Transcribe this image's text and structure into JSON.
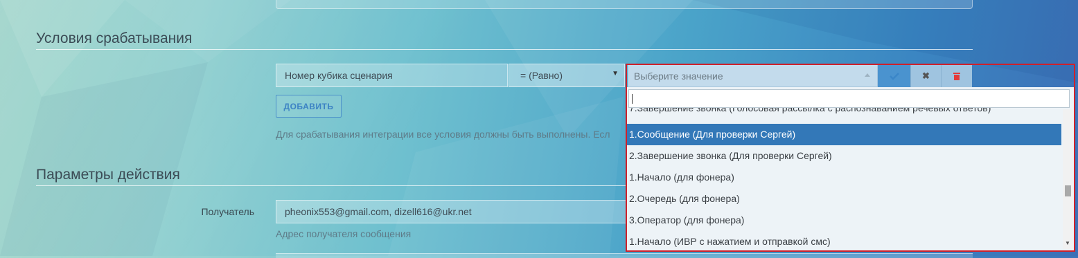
{
  "sections": {
    "conditions_title": "Условия срабатывания",
    "action_title": "Параметры действия"
  },
  "condition": {
    "field_value": "Номер кубика сценария",
    "operator_value": "= (Равно)",
    "value_placeholder": "Выберите значение",
    "add_label": "ДОБАВИТЬ",
    "hint": "Для срабатывания интеграции все условия должны быть выполнены. Есл"
  },
  "recipient": {
    "label": "Получатель",
    "value": "pheonix553@gmail.com, dizell616@ukr.net",
    "hint": "Адрес получателя сообщения"
  },
  "dropdown": {
    "search_value": "",
    "partial_option": "7.Завершение звонка (Голосовая рассылка с распознаванием речевых ответов)",
    "options": [
      "1.Сообщение (Для проверки Сергей)",
      "2.Завершение звонка (Для проверки Сергей)",
      "1.Начало (для фонера)",
      "2.Очередь (для фонера)",
      "3.Оператор (для фонера)",
      "1.Начало (ИВР с нажатием и отправкой смс)"
    ],
    "selected_index": 0
  },
  "icons": {
    "confirm": "check-icon",
    "cancel": "close-icon",
    "delete": "trash-icon"
  },
  "colors": {
    "highlight": "#d0202a",
    "selected_option": "#3378b8",
    "accent": "#3c82c4"
  }
}
